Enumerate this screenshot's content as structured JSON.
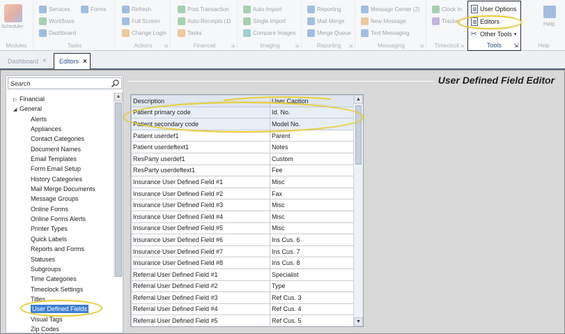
{
  "ribbon": {
    "scheduler_label": "Scheduler",
    "modules_label": "Modules",
    "tasks_group": {
      "items": [
        "Services",
        "Forms",
        "Workflows",
        "Dashboard"
      ],
      "label": "Tasks"
    },
    "actions_group": {
      "items": [
        "Refresh",
        "Full Screen",
        "Change Login"
      ],
      "label": "Actions"
    },
    "financial_group": {
      "items": [
        "Post Transaction",
        "Auto-Receipts (1)",
        "Tasks"
      ],
      "label": "Financial"
    },
    "imaging_group": {
      "items": [
        "Auto Import",
        "Single Import",
        "Compare Images"
      ],
      "label": "Imaging"
    },
    "reporting_group": {
      "items": [
        "Reporting",
        "Mail Merge",
        "Merge Queue"
      ],
      "label": "Reporting"
    },
    "messaging_group": {
      "items": [
        "Message Center (2)",
        "New Message",
        "Text Messaging"
      ],
      "label": "Messaging"
    },
    "timeclock_group": {
      "items": [
        "Clock In",
        "Tracker"
      ],
      "label": "Timeclock"
    },
    "tools_group": {
      "user_options": "User Options",
      "editors": "Editors",
      "other_tools": "Other Tools",
      "label": "Tools"
    },
    "help_group": {
      "help": "Help",
      "label": "Help"
    }
  },
  "tabs": {
    "dashboard": "Dashboard",
    "editors": "Editors",
    "close_glyph": "×"
  },
  "leftnav": {
    "search_placeholder": "Search",
    "financial": "Financial",
    "general": "General",
    "general_items": [
      "Alerts",
      "Appliances",
      "Contact Categories",
      "Document Names",
      "Email Templates",
      "Form Email Setup",
      "History Categories",
      "Mail Merge Documents",
      "Message Groups",
      "Online Forms",
      "Online Forms Alerts",
      "Printer Types",
      "Quick Labels",
      "Reports and Forms",
      "Statuses",
      "Subgroups",
      "Time Categories",
      "Timeclock Settings",
      "Titles",
      "User Defined Fields",
      "Visual Tags",
      "Zip Codes"
    ]
  },
  "editor": {
    "title": "User Defined Field Editor",
    "columns": [
      "Description",
      "User Caption"
    ],
    "rows": [
      [
        "Patient primary code",
        "Id. No."
      ],
      [
        "Patient secondary code",
        "Model No."
      ],
      [
        "Patient userdef1",
        "Parent"
      ],
      [
        "Patient userdeftext1",
        "Notes"
      ],
      [
        "ResParty userdef1",
        "Custom"
      ],
      [
        "ResParty userdeftext1",
        "Fee"
      ],
      [
        "Insurance User Defined Field #1",
        "Misc"
      ],
      [
        "Insurance User Defined Field #2",
        "Fax"
      ],
      [
        "Insurance User Defined Field #3",
        "Misc"
      ],
      [
        "Insurance User Defined Field #4",
        "Misc"
      ],
      [
        "Insurance User Defined Field #5",
        "Misc"
      ],
      [
        "Insurance User Defined Field #6",
        "Ins Cus. 6"
      ],
      [
        "Insurance User Defined Field #7",
        "Ins Cus. 7"
      ],
      [
        "Insurance User Defined Field #8",
        "Ins Cus. 8"
      ],
      [
        "Referral User Defined Field #1",
        "Specialist"
      ],
      [
        "Referral User Defined Field #2",
        "Type"
      ],
      [
        "Referral User Defined Field #3",
        "Ref Cus. 3"
      ],
      [
        "Referral User Defined Field #4",
        "Ref Cus. 4"
      ],
      [
        "Referral User Defined Field #5",
        "Ref Cus. 5"
      ]
    ]
  },
  "colors": {
    "highlight": "#e8cf3a",
    "selection": "#3d7fd0",
    "panel_bg": "#d9d9d9"
  }
}
